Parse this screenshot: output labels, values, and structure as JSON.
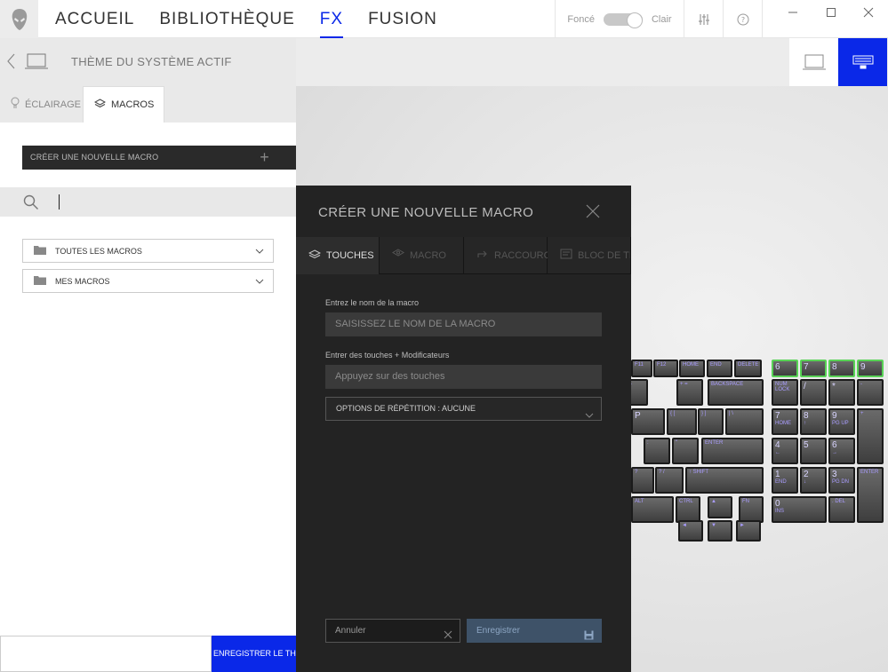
{
  "app": {
    "accent_color": "#0a28e8"
  },
  "nav": {
    "items": [
      "ACCUEIL",
      "BIBLIOTHÈQUE",
      "FX",
      "FUSION"
    ],
    "active_index": 2
  },
  "theme_toggle": {
    "dark_label": "Foncé",
    "light_label": "Clair"
  },
  "left_panel": {
    "header_title": "THÈME DU SYSTÈME ACTIF",
    "tabs": [
      {
        "label": "ÉCLAIRAGE",
        "icon": "bulb-icon"
      },
      {
        "label": "MACROS",
        "icon": "macro-layers-icon",
        "active": true
      }
    ],
    "create_macro_label": "CRÉER UNE NOUVELLE MACRO",
    "folders": [
      "TOUTES LES MACROS",
      "MES MACROS"
    ],
    "save_theme_label": "ENREGISTRER LE THÈME"
  },
  "modal": {
    "title": "CRÉER UNE NOUVELLE MACRO",
    "tabs": [
      "TOUCHES",
      "MACRO",
      "RACCOURCI",
      "BLOC DE TEXTE"
    ],
    "active_tab": 0,
    "name_label": "Entrez le nom de la macro",
    "name_placeholder": "SAISISSEZ LE NOM DE LA MACRO",
    "keys_label": "Entrer des touches + Modificateurs",
    "keys_placeholder": "Appuyez sur des touches",
    "repeat_option": "OPTIONS DE RÉPÉTITION : AUCUNE",
    "cancel_label": "Annuler",
    "save_label": "Enregistrer"
  },
  "keyboard": {
    "keys": [
      {
        "big": "",
        "small": "F11"
      },
      {
        "big": "",
        "small": "F12"
      },
      {
        "big": "",
        "small": "HOME"
      },
      {
        "big": "",
        "small": "END"
      },
      {
        "big": "",
        "small": "DELETE"
      },
      {
        "big": "6",
        "small": ""
      },
      {
        "big": "7",
        "small": ""
      },
      {
        "big": "8",
        "small": ""
      },
      {
        "big": "9",
        "small": ""
      },
      {
        "big": "",
        "small": "-"
      },
      {
        "big": "",
        "small": "+ ="
      },
      {
        "big": "",
        "small": "BACKSPACE"
      },
      {
        "big": "",
        "small": "NUM LOCK"
      },
      {
        "big": "/",
        "small": ""
      },
      {
        "big": "*",
        "small": ""
      },
      {
        "big": "",
        "small": "-"
      },
      {
        "big": "P",
        "small": ""
      },
      {
        "big": "",
        "small": "{ ["
      },
      {
        "big": "",
        "small": "} ]"
      },
      {
        "big": "",
        "small": "| \\"
      },
      {
        "big": "7",
        "small": "HOME"
      },
      {
        "big": "8",
        "small": "↑"
      },
      {
        "big": "9",
        "small": "PG UP"
      },
      {
        "big": "",
        "small": "+"
      },
      {
        "big": "",
        "small": ":"
      },
      {
        "big": "",
        "small": "\""
      },
      {
        "big": "",
        "small": "ENTER"
      },
      {
        "big": "4",
        "small": "←"
      },
      {
        "big": "5",
        "small": ""
      },
      {
        "big": "6",
        "small": "→"
      },
      {
        "big": "",
        "small": "?"
      },
      {
        "big": "",
        "small": "?  /"
      },
      {
        "big": "",
        "small": "↑ SHIFT"
      },
      {
        "big": "1",
        "small": "END"
      },
      {
        "big": "2",
        "small": "↓"
      },
      {
        "big": "3",
        "small": "PG DN"
      },
      {
        "big": "",
        "small": "ENTER"
      },
      {
        "big": "",
        "small": "ALT"
      },
      {
        "big": "",
        "small": "CTRL"
      },
      {
        "big": "",
        "small": "▲"
      },
      {
        "big": "",
        "small": "FN"
      },
      {
        "big": "0",
        "small": "INS"
      },
      {
        "big": "",
        "small": ". DEL"
      },
      {
        "big": "",
        "small": "◄"
      },
      {
        "big": "",
        "small": "▼"
      },
      {
        "big": "",
        "small": "►"
      }
    ]
  }
}
